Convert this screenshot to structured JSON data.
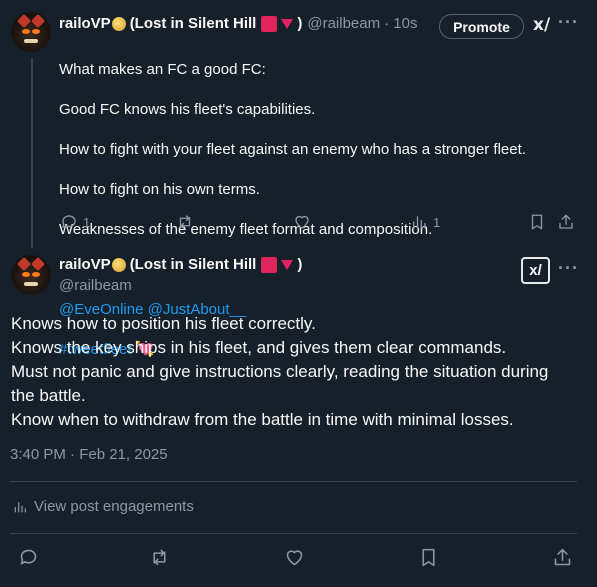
{
  "tweet1": {
    "name": "railoVP",
    "name_suffix": "(Lost in Silent Hill",
    "name_close": ")",
    "handle": "@railbeam",
    "time": "· 10s",
    "promote_label": "Promote",
    "lines": [
      "What makes an FC a good FC:",
      "Good FC knows his fleet's capabilities.",
      "How to fight with your fleet against an enemy who has a stronger fleet.",
      "How to fight on his own terms.",
      "Weaknesses of the enemy fleet format and composition."
    ],
    "mentions": "@EveOnline @JustAbout__",
    "hashtag": "#tweetfleet",
    "hashtag_emoji": "💘",
    "reply_count": "1",
    "views_count": "1"
  },
  "tweet2": {
    "name": "railoVP",
    "name_suffix": "(Lost in Silent Hill",
    "name_close": ")",
    "handle": "@railbeam",
    "text": "Knows how to position his fleet correctly.\nKnows the key ships in his fleet, and gives them clear commands.\nMust not panic and give instructions clearly, reading the situation during\nthe battle.\nKnow when to withdraw from the battle in time with minimal losses.",
    "timestamp": "3:40 PM · Feb 21, 2025",
    "engagements_label": "View post engagements"
  },
  "icons": {
    "grok": "x-slash",
    "more": "···"
  },
  "colors": {
    "background": "#15202b",
    "link": "#1d9bf0",
    "muted": "#8b98a5",
    "accent_red": "#e0245e"
  }
}
